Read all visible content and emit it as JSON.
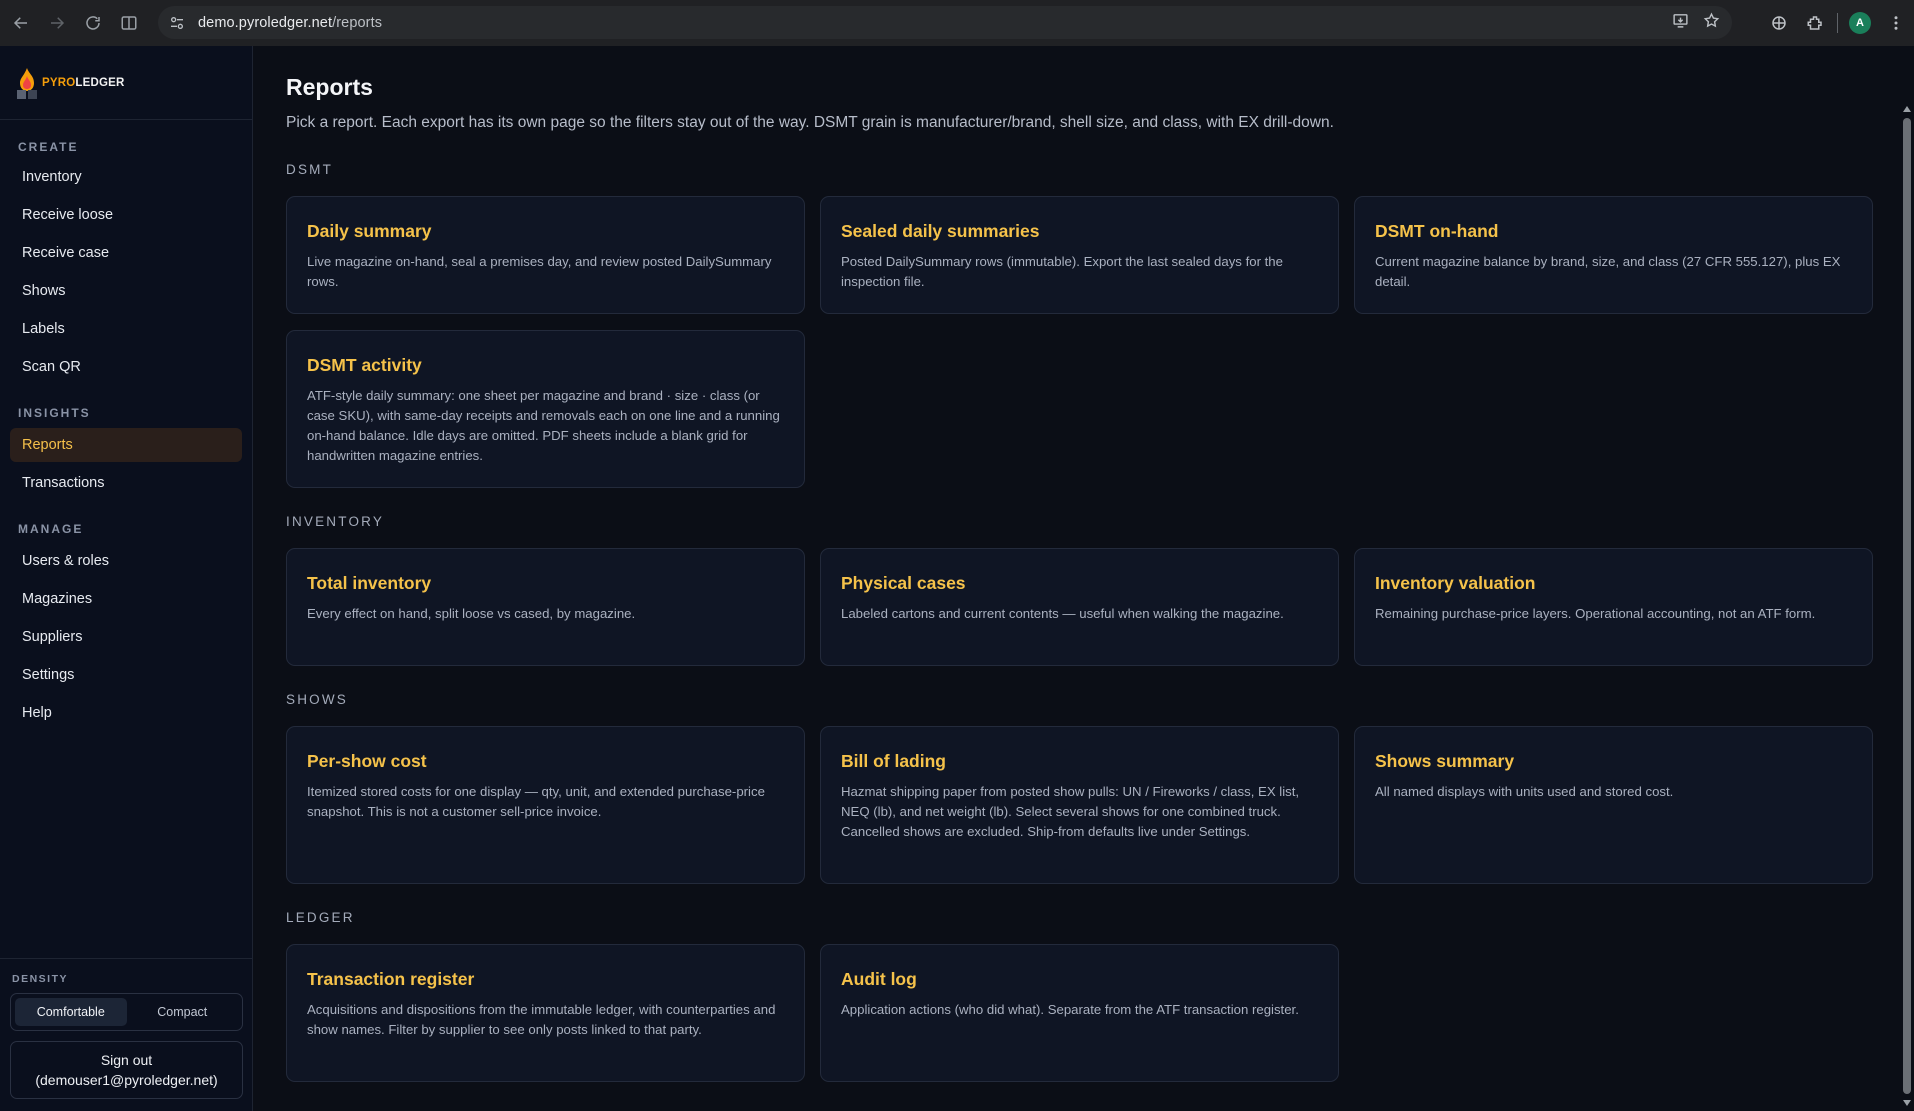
{
  "browser": {
    "url_host": "demo.pyroledger.net",
    "url_path": "/reports",
    "avatar_letter": "A"
  },
  "brand": {
    "part1": "PYRO",
    "part2": "LEDGER",
    "accent": "#f59e0b"
  },
  "sidebar": {
    "sections": [
      {
        "label": "CREATE",
        "items": [
          "Inventory",
          "Receive loose",
          "Receive case",
          "Shows",
          "Labels",
          "Scan QR"
        ]
      },
      {
        "label": "INSIGHTS",
        "items": [
          "Reports",
          "Transactions"
        ]
      },
      {
        "label": "MANAGE",
        "items": [
          "Users & roles",
          "Magazines",
          "Suppliers",
          "Settings",
          "Help"
        ]
      }
    ],
    "active_item": "Reports",
    "density": {
      "label": "DENSITY",
      "options": [
        "Comfortable",
        "Compact"
      ],
      "selected": "Comfortable"
    },
    "signout": {
      "label": "Sign out",
      "user": "(demouser1@pyroledger.net)"
    }
  },
  "page": {
    "title": "Reports",
    "subtitle": "Pick a report. Each export has its own page so the filters stay out of the way. DSMT grain is manufacturer/brand, shell size, and class, with EX drill-down.",
    "groups": [
      {
        "label": "DSMT",
        "cards": [
          {
            "title": "Daily summary",
            "desc": "Live magazine on-hand, seal a premises day, and review posted DailySummary rows."
          },
          {
            "title": "Sealed daily summaries",
            "desc": "Posted DailySummary rows (immutable). Export the last sealed days for the inspection file."
          },
          {
            "title": "DSMT on-hand",
            "desc": "Current magazine balance by brand, size, and class (27 CFR 555.127), plus EX detail."
          },
          {
            "title": "DSMT activity",
            "desc": "ATF-style daily summary: one sheet per magazine and brand · size · class (or case SKU), with same-day receipts and removals each on one line and a running on-hand balance. Idle days are omitted. PDF sheets include a blank grid for handwritten magazine entries."
          }
        ]
      },
      {
        "label": "INVENTORY",
        "cards": [
          {
            "title": "Total inventory",
            "desc": "Every effect on hand, split loose vs cased, by magazine."
          },
          {
            "title": "Physical cases",
            "desc": "Labeled cartons and current contents — useful when walking the magazine."
          },
          {
            "title": "Inventory valuation",
            "desc": "Remaining purchase-price layers. Operational accounting, not an ATF form."
          }
        ]
      },
      {
        "label": "SHOWS",
        "cards": [
          {
            "title": "Per-show cost",
            "desc": "Itemized stored costs for one display — qty, unit, and extended purchase-price snapshot. This is not a customer sell-price invoice."
          },
          {
            "title": "Bill of lading",
            "desc": "Hazmat shipping paper from posted show pulls: UN / Fireworks / class, EX list, NEQ (lb), and net weight (lb). Select several shows for one combined truck. Cancelled shows are excluded. Ship-from defaults live under Settings."
          },
          {
            "title": "Shows summary",
            "desc": "All named displays with units used and stored cost."
          }
        ]
      },
      {
        "label": "LEDGER",
        "cards": [
          {
            "title": "Transaction register",
            "desc": "Acquisitions and dispositions from the immutable ledger, with counterparties and show names. Filter by supplier to see only posts linked to that party."
          },
          {
            "title": "Audit log",
            "desc": "Application actions (who did what). Separate from the ATF transaction register."
          }
        ]
      }
    ]
  },
  "colors": {
    "card_title": "#f5c24a",
    "active_bg": "#2a1f1b",
    "background": "#0b0e16"
  }
}
